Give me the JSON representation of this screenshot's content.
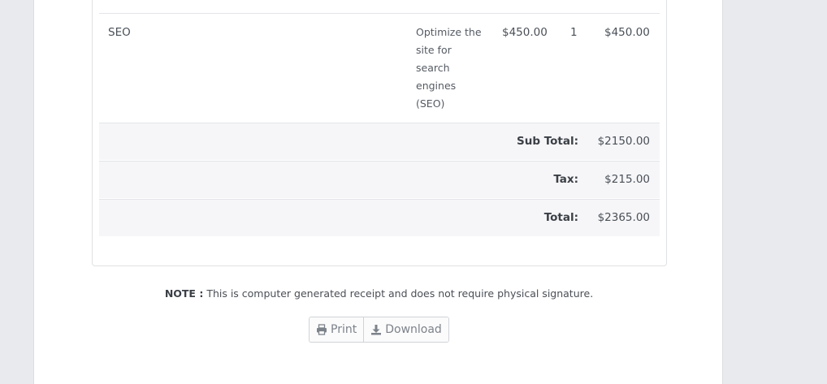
{
  "invoice": {
    "item": {
      "name": "SEO",
      "description": "Optimize the site for search engines (SEO)",
      "price": "$450.00",
      "quantity": "1",
      "amount": "$450.00"
    },
    "summary": [
      {
        "label": "Sub Total:",
        "value": "$2150.00"
      },
      {
        "label": "Tax:",
        "value": "$215.00"
      },
      {
        "label": "Total:",
        "value": "$2365.00"
      }
    ]
  },
  "note": {
    "label": "NOTE :",
    "text": "This is computer generated receipt and does not require physical signature."
  },
  "actions": {
    "print_label": "Print",
    "print_icon": "printer-icon",
    "download_label": "Download",
    "download_icon": "download-icon"
  }
}
